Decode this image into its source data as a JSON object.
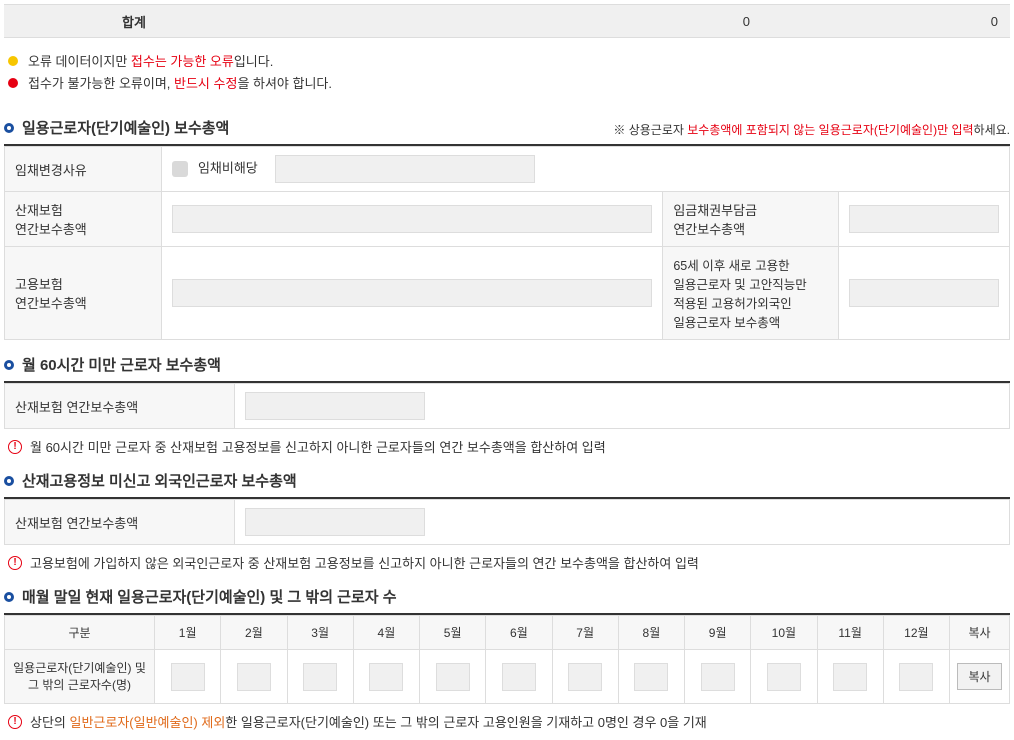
{
  "total": {
    "label": "합계",
    "val1": "0",
    "val2": "0"
  },
  "legend": {
    "yellow_pre": "오류 데이터이지만 ",
    "yellow_red": "접수는 가능한 오류",
    "yellow_post": "입니다.",
    "red_pre": "접수가 불가능한 오류이며, ",
    "red_red": "반드시 수정",
    "red_post": "을 하셔야 합니다."
  },
  "s1": {
    "title": "일용근로자(단기예술인) 보수총액",
    "note_pre": "※ 상용근로자 ",
    "note_red": "보수총액에 포함되지 않는 일용근로자(단기예술인)만 입력",
    "note_post": "하세요.",
    "row1_label": "임채변경사유",
    "row1_chk": "임채비해당",
    "row2_label": "산재보험\n연간보수총액",
    "row2_right": "임금채권부담금\n연간보수총액",
    "row3_label": "고용보험\n연간보수총액",
    "row3_right": "65세 이후 새로 고용한\n일용근로자 및 고안직능만\n적용된 고용허가외국인\n일용근로자 보수총액"
  },
  "s2": {
    "title": "월 60시간 미만 근로자 보수총액",
    "label": "산재보험 연간보수총액",
    "info": "월 60시간 미만 근로자 중 산재보험 고용정보를 신고하지 아니한 근로자들의 연간 보수총액을 합산하여 입력"
  },
  "s3": {
    "title": "산재고용정보 미신고 외국인근로자 보수총액",
    "label": "산재보험 연간보수총액",
    "info": "고용보험에 가입하지 않은 외국인근로자 중 산재보험 고용정보를 신고하지 아니한 근로자들의 연간 보수총액을 합산하여 입력"
  },
  "s4": {
    "title": "매월 말일 현재 일용근로자(단기예술인) 및 그 밖의 근로자 수",
    "col_gu": "구분",
    "months": [
      "1월",
      "2월",
      "3월",
      "4월",
      "5월",
      "6월",
      "7월",
      "8월",
      "9월",
      "10월",
      "11월",
      "12월"
    ],
    "col_copy": "복사",
    "row_label": "일용근로자(단기예술인) 및\n그 밖의  근로자수(명)",
    "copy_btn": "복사",
    "info_pre": "상단의 ",
    "info_orange": "일반근로자(일반예술인) 제외",
    "info_post": "한 일용근로자(단기예술인) 또는 그 밖의 근로자 고용인원을 기재하고 0명인 경우 0을 기재"
  }
}
